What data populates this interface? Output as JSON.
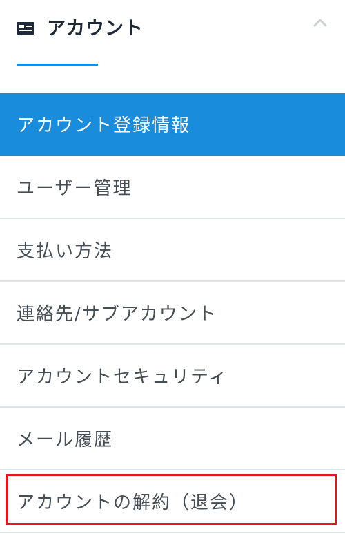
{
  "header": {
    "title": "アカウント",
    "icon": "id-card-icon",
    "collapse_icon": "chevron-up-icon",
    "underline_color": "#1a8cdc"
  },
  "menu": {
    "items": [
      {
        "label": "アカウント登録情報",
        "state": "active"
      },
      {
        "label": "ユーザー管理",
        "state": "default"
      },
      {
        "label": "支払い方法",
        "state": "default"
      },
      {
        "label": "連絡先/サブアカウント",
        "state": "default"
      },
      {
        "label": "アカウントセキュリティ",
        "state": "default"
      },
      {
        "label": "メール履歴",
        "state": "default"
      },
      {
        "label": "アカウントの解約（退会）",
        "state": "highlighted"
      }
    ]
  },
  "colors": {
    "accent": "#1a8cdc",
    "text": "#454d55",
    "title": "#1f2a36",
    "divider": "#dde4ea",
    "highlight_border": "#e8141c"
  }
}
